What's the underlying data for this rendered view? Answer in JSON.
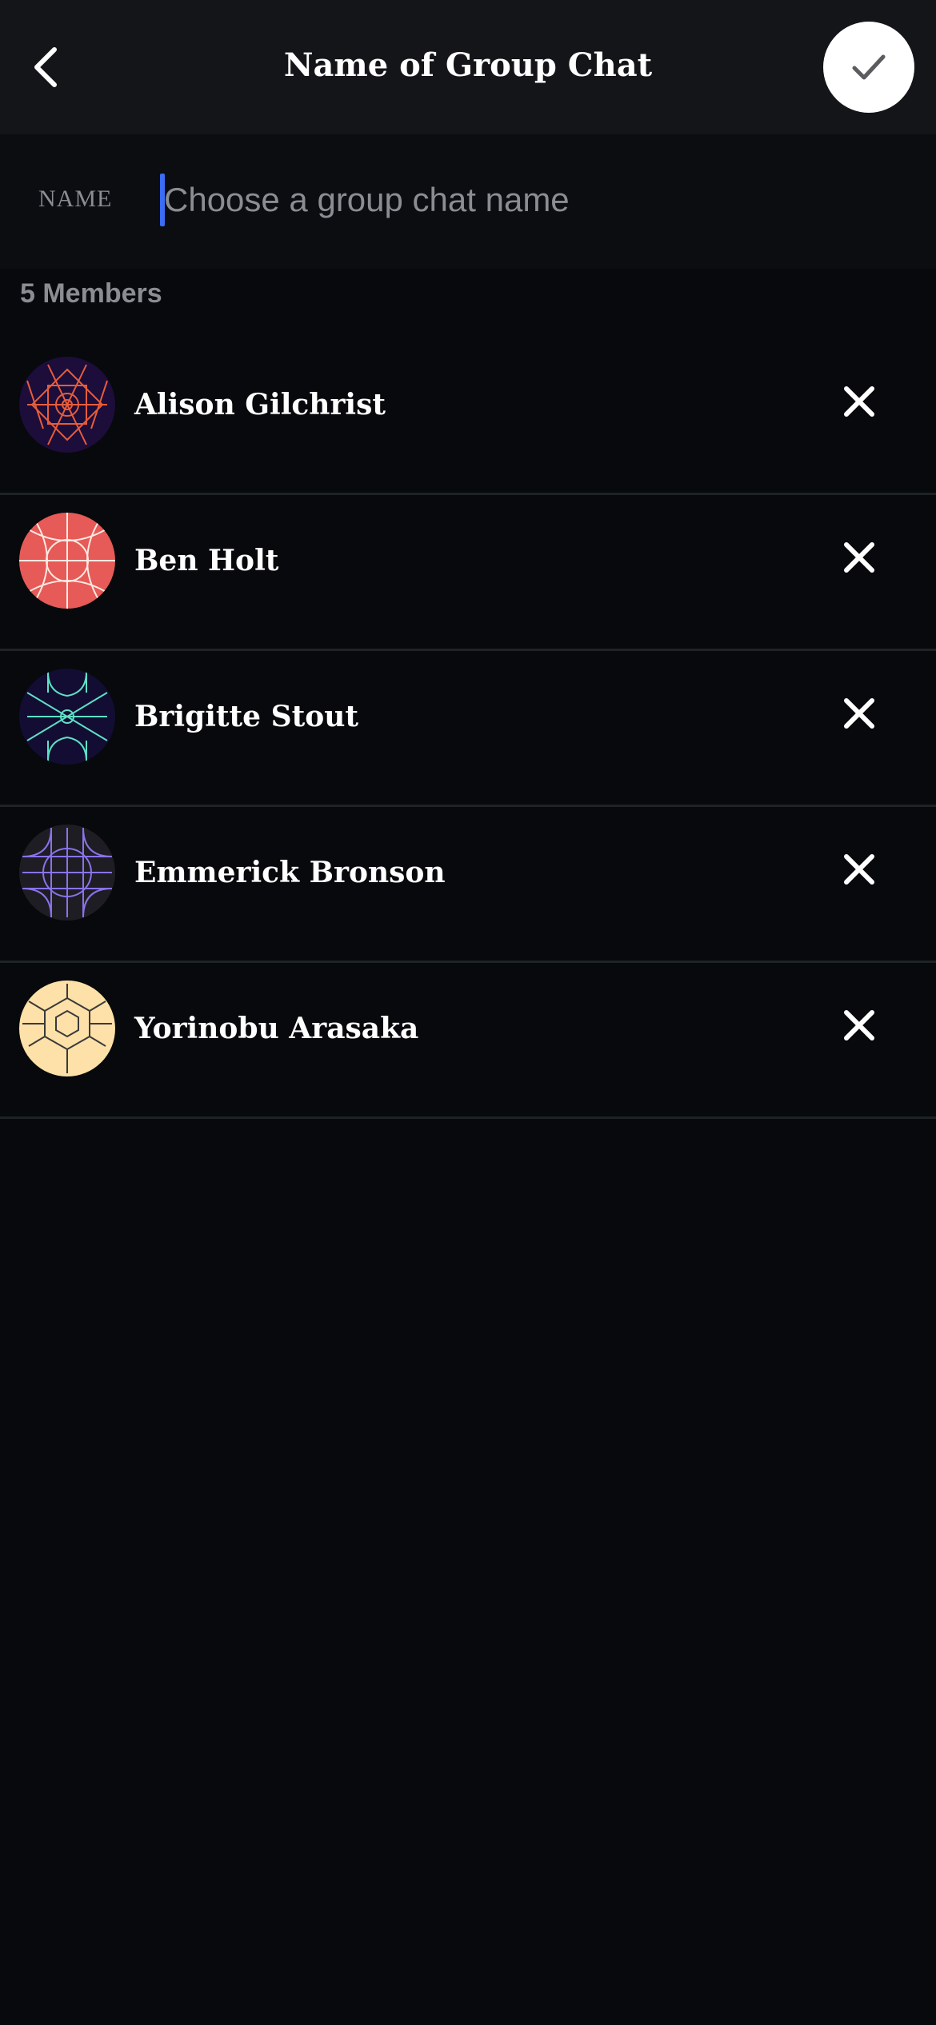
{
  "header": {
    "title": "Name of Group Chat",
    "back_icon": "chevron-left-icon",
    "confirm_icon": "checkmark-icon"
  },
  "name_field": {
    "label": "NAME",
    "placeholder": "Choose a group chat name",
    "value": ""
  },
  "members_count_label": "5 Members",
  "members": [
    {
      "name": "Alison Gilchrist",
      "avatar_bg": "#1c0d3a",
      "avatar_line": "#e85c3a",
      "remove_icon": "close-icon"
    },
    {
      "name": "Ben Holt",
      "avatar_bg": "#e65a57",
      "avatar_line": "#ffe9e2",
      "remove_icon": "close-icon"
    },
    {
      "name": "Brigitte Stout",
      "avatar_bg": "#130d33",
      "avatar_line": "#5fe0c4",
      "remove_icon": "close-icon"
    },
    {
      "name": "Emmerick Bronson",
      "avatar_bg": "#1f1d24",
      "avatar_line": "#8a73e8",
      "remove_icon": "close-icon"
    },
    {
      "name": "Yorinobu Arasaka",
      "avatar_bg": "#fde1a8",
      "avatar_line": "#3a3a3a",
      "remove_icon": "close-icon"
    }
  ],
  "colors": {
    "background": "#07090c",
    "header_bg": "#131519",
    "caret": "#3b6cf6",
    "muted_text": "#8a8d92"
  }
}
